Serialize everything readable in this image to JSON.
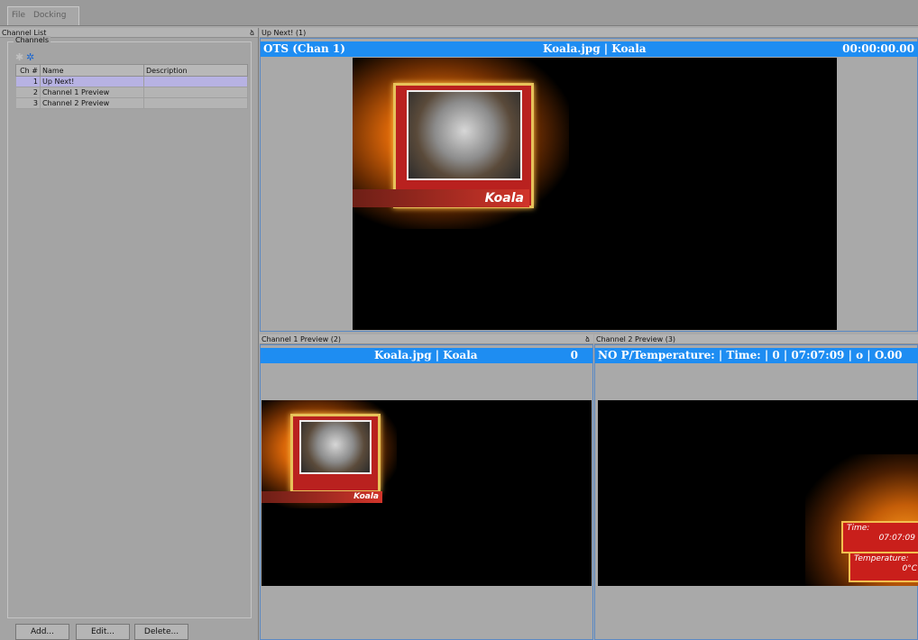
{
  "menu": {
    "file": "File",
    "docking": "Docking"
  },
  "left_panel": {
    "title": "Channel List",
    "pin": "ձ",
    "group_title": "Channels",
    "columns": [
      "Ch #",
      "Name",
      "Description"
    ],
    "rows": [
      {
        "num": "1",
        "name": "Up Next!",
        "description": ""
      },
      {
        "num": "2",
        "name": "Channel 1 Preview",
        "description": ""
      },
      {
        "num": "3",
        "name": "Channel 2 Preview",
        "description": ""
      }
    ],
    "buttons": {
      "add": "Add...",
      "edit": "Edit...",
      "delete": "Delete..."
    }
  },
  "top_pane": {
    "title": "Up Next! (1)",
    "bar_left": "OTS  (Chan 1)",
    "bar_center": "Koala.jpg | Koala",
    "bar_right": "00:00:00.00",
    "caption": "Koala"
  },
  "left_preview": {
    "title": "Channel 1 Preview (2)",
    "pin": "ձ",
    "bar_center": "Koala.jpg | Koala",
    "bar_right": "0",
    "caption": "Koala"
  },
  "right_preview": {
    "title": "Channel 2 Preview (3)",
    "bar_text": "NO P/Temperature: | Time: | 0 | 07:07:09 | o | O.00",
    "time_label": "Time:",
    "time_value": "07:07:09",
    "temp_label": "Temperature:",
    "temp_value": "0°C"
  },
  "colors": {
    "accent_blue": "#1e8df2",
    "selected_row": "#b7b2e3"
  }
}
